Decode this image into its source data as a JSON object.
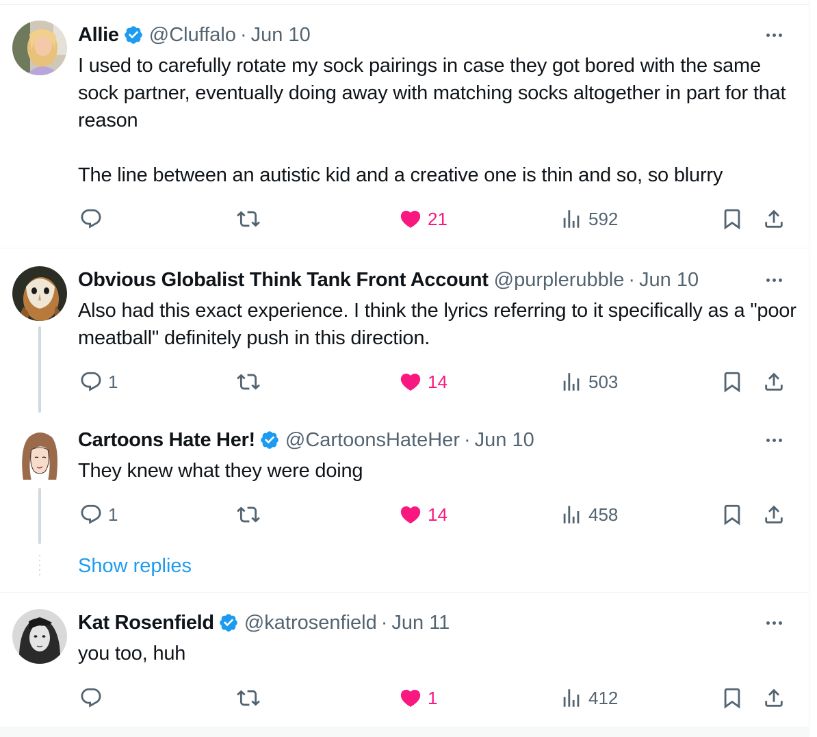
{
  "colors": {
    "text": "#0f1419",
    "muted": "#536471",
    "accent": "#1d9bf0",
    "like": "#f91880",
    "divider": "#eff3f4",
    "thread": "#cfd9de"
  },
  "tweets": [
    {
      "name": "Allie",
      "verified": true,
      "handle": "@Cluffalo",
      "separator": "·",
      "date": "Jun 10",
      "text": "I used to carefully rotate my sock pairings in case they got bored with the same sock partner, eventually doing away with matching socks altogether in part for that reason\n\nThe line between an autistic kid and a creative one is thin and so, so blurry",
      "avatar_icon": "blonde-woman-avatar",
      "replies": "",
      "retweets": "",
      "likes": "21",
      "views": "592"
    },
    {
      "name": "Obvious Globalist Think Tank Front Account",
      "verified": false,
      "handle": "@purplerubble",
      "separator": "·",
      "date": "Jun 10",
      "text": "Also had this exact experience. I think the lyrics referring to it specifically as a \"poor meatball\" definitely push in this direction.",
      "avatar_icon": "barn-owl-avatar",
      "replies": "1",
      "retweets": "",
      "likes": "14",
      "views": "503"
    },
    {
      "name": "Cartoons Hate Her!",
      "verified": true,
      "handle": "@CartoonsHateHer",
      "separator": "·",
      "date": "Jun 10",
      "text": "They knew what they were doing",
      "avatar_icon": "drawn-woman-avatar",
      "replies": "1",
      "retweets": "",
      "likes": "14",
      "views": "458"
    },
    {
      "name": "Kat Rosenfield",
      "verified": true,
      "handle": "@katrosenfield",
      "separator": "·",
      "date": "Jun 11",
      "text": "you too, huh",
      "avatar_icon": "bw-portrait-avatar",
      "replies": "",
      "retweets": "",
      "likes": "1",
      "views": "412"
    }
  ],
  "show_replies_label": "Show replies"
}
